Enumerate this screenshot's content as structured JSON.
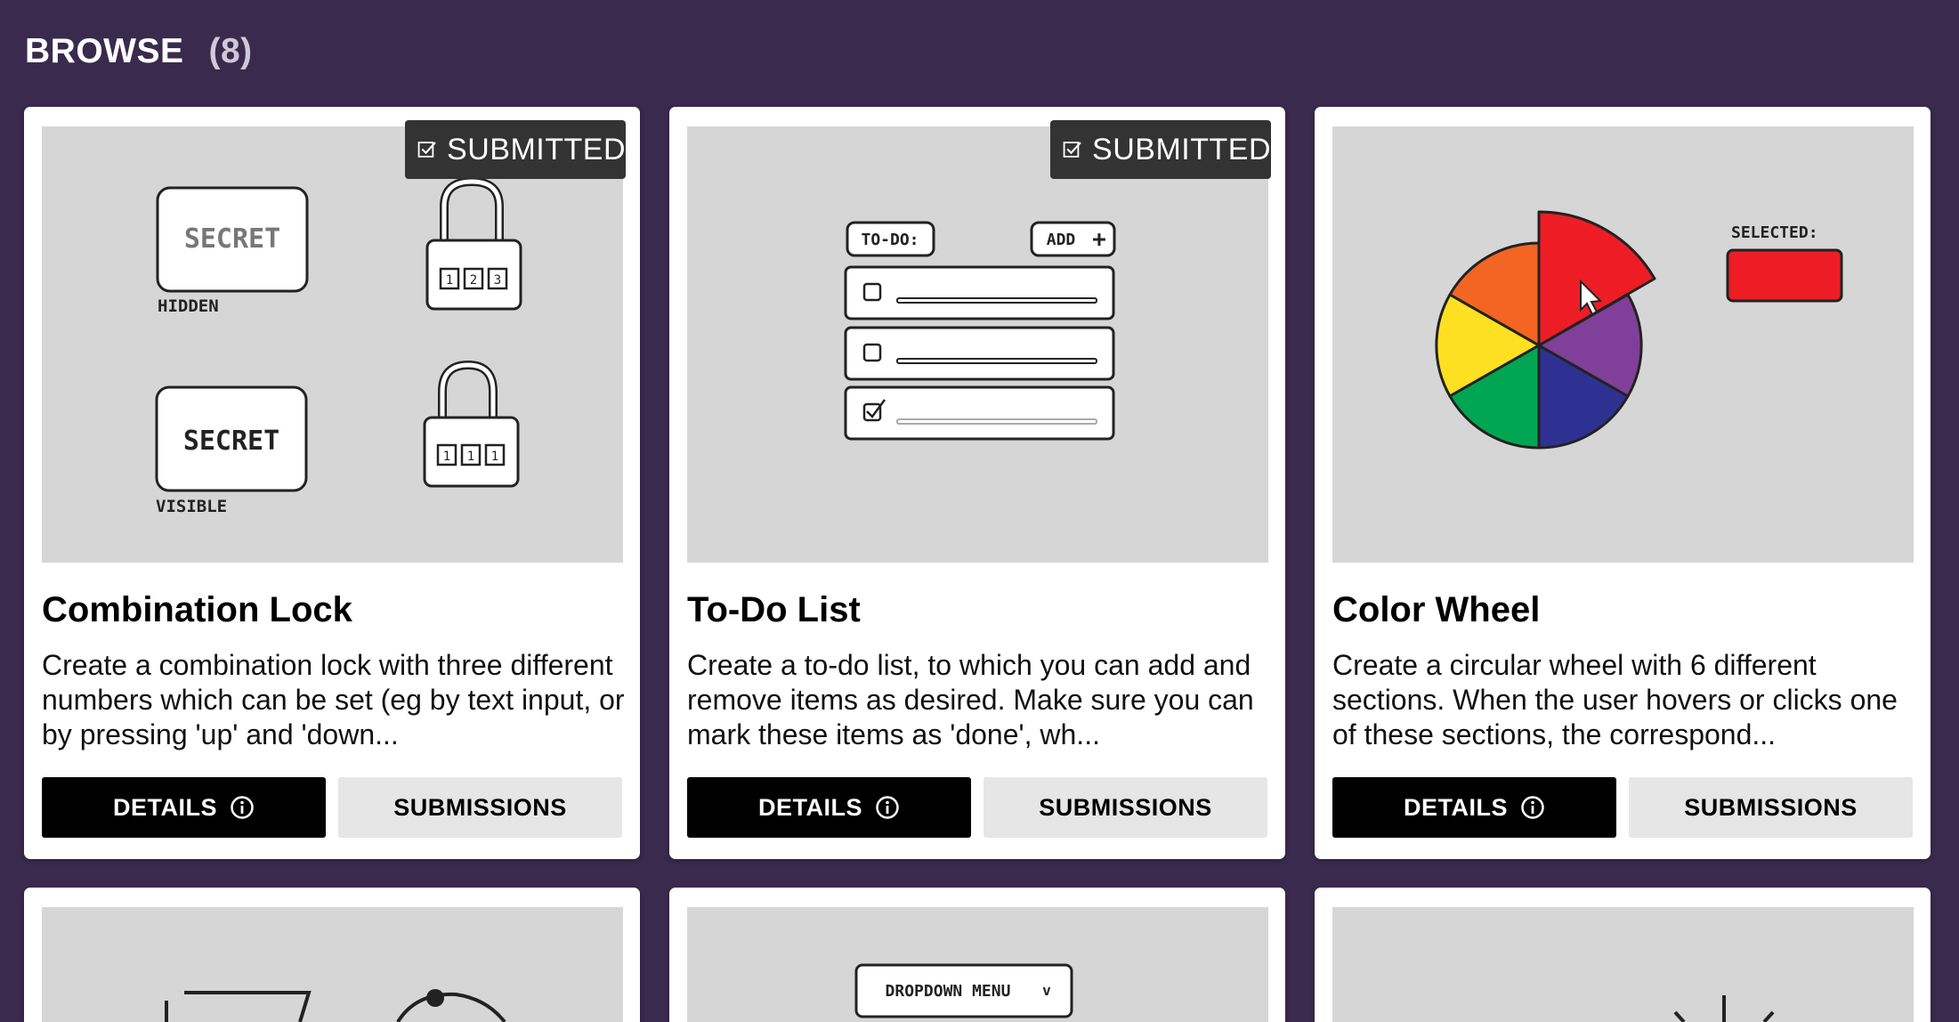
{
  "header": {
    "title": "BROWSE",
    "count": "(8)"
  },
  "badge_label": "SUBMITTED",
  "buttons": {
    "details": "DETAILS",
    "submissions": "SUBMISSIONS"
  },
  "colors": {
    "background": "#3a2a4e",
    "details_button": "#000000",
    "submissions_button": "#e6e6e6",
    "badge": "#333333",
    "thumbnail": "#d6d6d6"
  },
  "cards": [
    {
      "title": "Combination Lock",
      "description": "Create a combination lock with three different numbers which can be set (eg by text input, or by pressing 'up' and 'down...",
      "submitted": true,
      "illustration": {
        "secret": "SECRET",
        "hidden": "HIDDEN",
        "visible": "VISIBLE",
        "locked_digits": [
          "1",
          "2",
          "3"
        ],
        "unlocked_digits": [
          "1",
          "1",
          "1"
        ]
      }
    },
    {
      "title": "To-Do List",
      "description": "Create a to-do list, to which you can add and remove items as desired. Make sure you can mark these items as 'done', wh...",
      "submitted": true,
      "illustration": {
        "todo": "TO-DO:",
        "add": "ADD",
        "add_symbol": "+"
      }
    },
    {
      "title": "Color Wheel",
      "description": "Create a circular wheel with 6 different sections. When the user hovers or clicks one of these sections, the correspond...",
      "submitted": false,
      "illustration": {
        "selected": "SELECTED:",
        "selected_color": "#ee1c25",
        "segments": [
          "#ee1c25",
          "#f26522",
          "#fde021",
          "#00a651",
          "#2e3192",
          "#803f98"
        ]
      }
    },
    {
      "title": "",
      "description": "",
      "submitted": false
    },
    {
      "title": "",
      "description": "",
      "submitted": false,
      "illustration": {
        "dropdown": "DROPDOWN MENU",
        "chevron": "v"
      }
    },
    {
      "title": "",
      "description": "",
      "submitted": false
    }
  ]
}
